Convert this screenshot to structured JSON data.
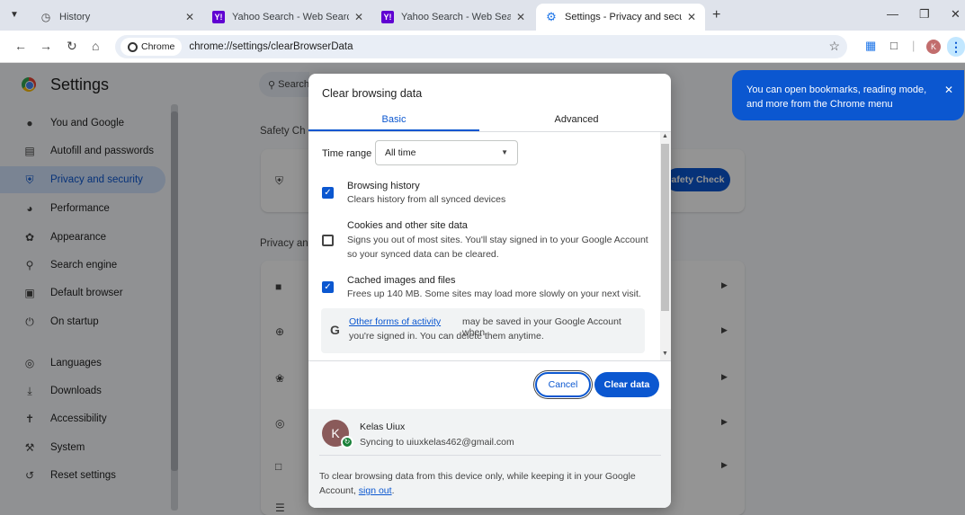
{
  "tabs": [
    {
      "label": "History",
      "favicon": "history-icon"
    },
    {
      "label": "Yahoo Search - Web Search",
      "favicon": "yahoo-icon"
    },
    {
      "label": "Yahoo Search - Web Search",
      "favicon": "yahoo-icon"
    },
    {
      "label": "Settings - Privacy and security",
      "favicon": "gear-icon",
      "active": true
    }
  ],
  "address_bar": {
    "chip_label": "Chrome",
    "url": "chrome://settings/clearBrowserData",
    "profile_initial": "K"
  },
  "settings": {
    "title": "Settings",
    "search_placeholder": "Search",
    "sidebar": [
      {
        "label": "You and Google",
        "icon": "person-icon"
      },
      {
        "label": "Autofill and passwords",
        "icon": "clipboard-icon"
      },
      {
        "label": "Privacy and security",
        "icon": "shield-icon",
        "active": true
      },
      {
        "label": "Performance",
        "icon": "speedometer-icon"
      },
      {
        "label": "Appearance",
        "icon": "palette-icon"
      },
      {
        "label": "Search engine",
        "icon": "search-icon"
      },
      {
        "label": "Default browser",
        "icon": "browser-icon"
      },
      {
        "label": "On startup",
        "icon": "power-icon"
      },
      {
        "label": "Languages",
        "icon": "globe-icon"
      },
      {
        "label": "Downloads",
        "icon": "download-icon"
      },
      {
        "label": "Accessibility",
        "icon": "accessibility-icon"
      },
      {
        "label": "System",
        "icon": "wrench-icon"
      },
      {
        "label": "Reset settings",
        "icon": "reset-icon"
      }
    ],
    "safety_check_section": "Safety Ch",
    "safety_check_button": "afety Check",
    "privacy_section": "Privacy an"
  },
  "callout": {
    "text": "You can open bookmarks, reading mode, and more from the Chrome menu"
  },
  "dialog": {
    "title": "Clear browsing data",
    "tabs": {
      "basic": "Basic",
      "advanced": "Advanced"
    },
    "time_range_label": "Time range",
    "time_range_value": "All time",
    "options": [
      {
        "title": "Browsing history",
        "desc": "Clears history from all synced devices",
        "checked": true
      },
      {
        "title": "Cookies and other site data",
        "desc": "Signs you out of most sites. You'll stay signed in to your Google Account so your synced data can be cleared.",
        "checked": false
      },
      {
        "title": "Cached images and files",
        "desc": "Frees up 140 MB. Some sites may load more slowly on your next visit.",
        "checked": true
      }
    ],
    "info": {
      "link": "Other forms of activity",
      "text_line1": "may be saved in your Google Account when",
      "text_line2": "you're signed in. You can delete them anytime."
    },
    "cancel_label": "Cancel",
    "clear_label": "Clear data",
    "account": {
      "avatar_initial": "K",
      "name": "Kelas Uiux",
      "sync_text": "Syncing to uiuxkelas462@gmail.com"
    },
    "footer_note_line1": "To clear browsing data from this device only, while keeping it in your Google",
    "footer_note_prefix": "Account,",
    "footer_signout": "sign out",
    "footer_note_suffix": "."
  },
  "colors": {
    "accent": "#0b57d0",
    "active_nav_bg": "#d3e3fd",
    "tabstrip_bg": "#dfe3eb"
  }
}
